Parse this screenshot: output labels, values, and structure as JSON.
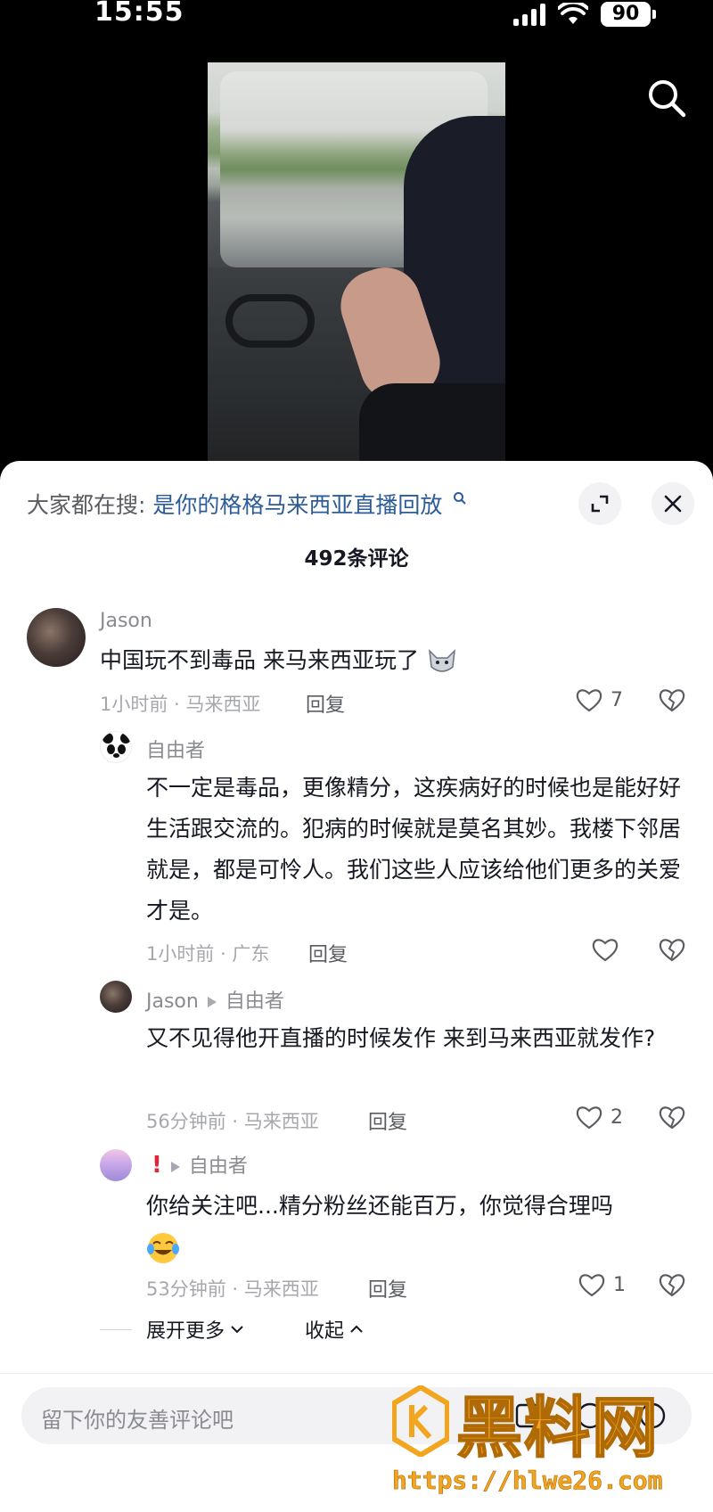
{
  "status_bar": {
    "time": "15:55",
    "battery": "90"
  },
  "hot_search": {
    "prefix": "大家都在搜:",
    "query": "是你的格格马来西亚直播回放"
  },
  "comment_count": "492条评论",
  "comments": [
    {
      "user": "Jason",
      "text": "中国玩不到毒品 来马来西亚玩了",
      "meta": "1小时前 · 马来西亚",
      "reply": "回复",
      "likes": "7"
    },
    {
      "user": "自由者",
      "text": "不一定是毒品，更像精分，这疾病好的时候也是能好好生活跟交流的。犯病的时候就是莫名其妙。我楼下邻居就是，都是可怜人。我们这些人应该给他们更多的关爱才是。",
      "meta": "1小时前 · 广东",
      "reply": "回复",
      "likes": ""
    },
    {
      "user": "Jason",
      "reply_to": "自由者",
      "text": "又不见得他开直播的时候发作 来到马来西亚就发作?",
      "meta": "56分钟前 · 马来西亚",
      "reply": "回复",
      "likes": "2"
    },
    {
      "user": "!",
      "reply_to": "自由者",
      "text": "你给关注吧...精分粉丝还能百万，你觉得合理吗",
      "meta": "53分钟前 · 马来西亚",
      "reply": "回复",
      "likes": "1"
    }
  ],
  "expand_more": "展开更多",
  "collapse": "收起",
  "input": {
    "placeholder": "留下你的友善评论吧"
  },
  "watermark": {
    "name": "黑料网",
    "url": "https://hlwe26.com"
  }
}
